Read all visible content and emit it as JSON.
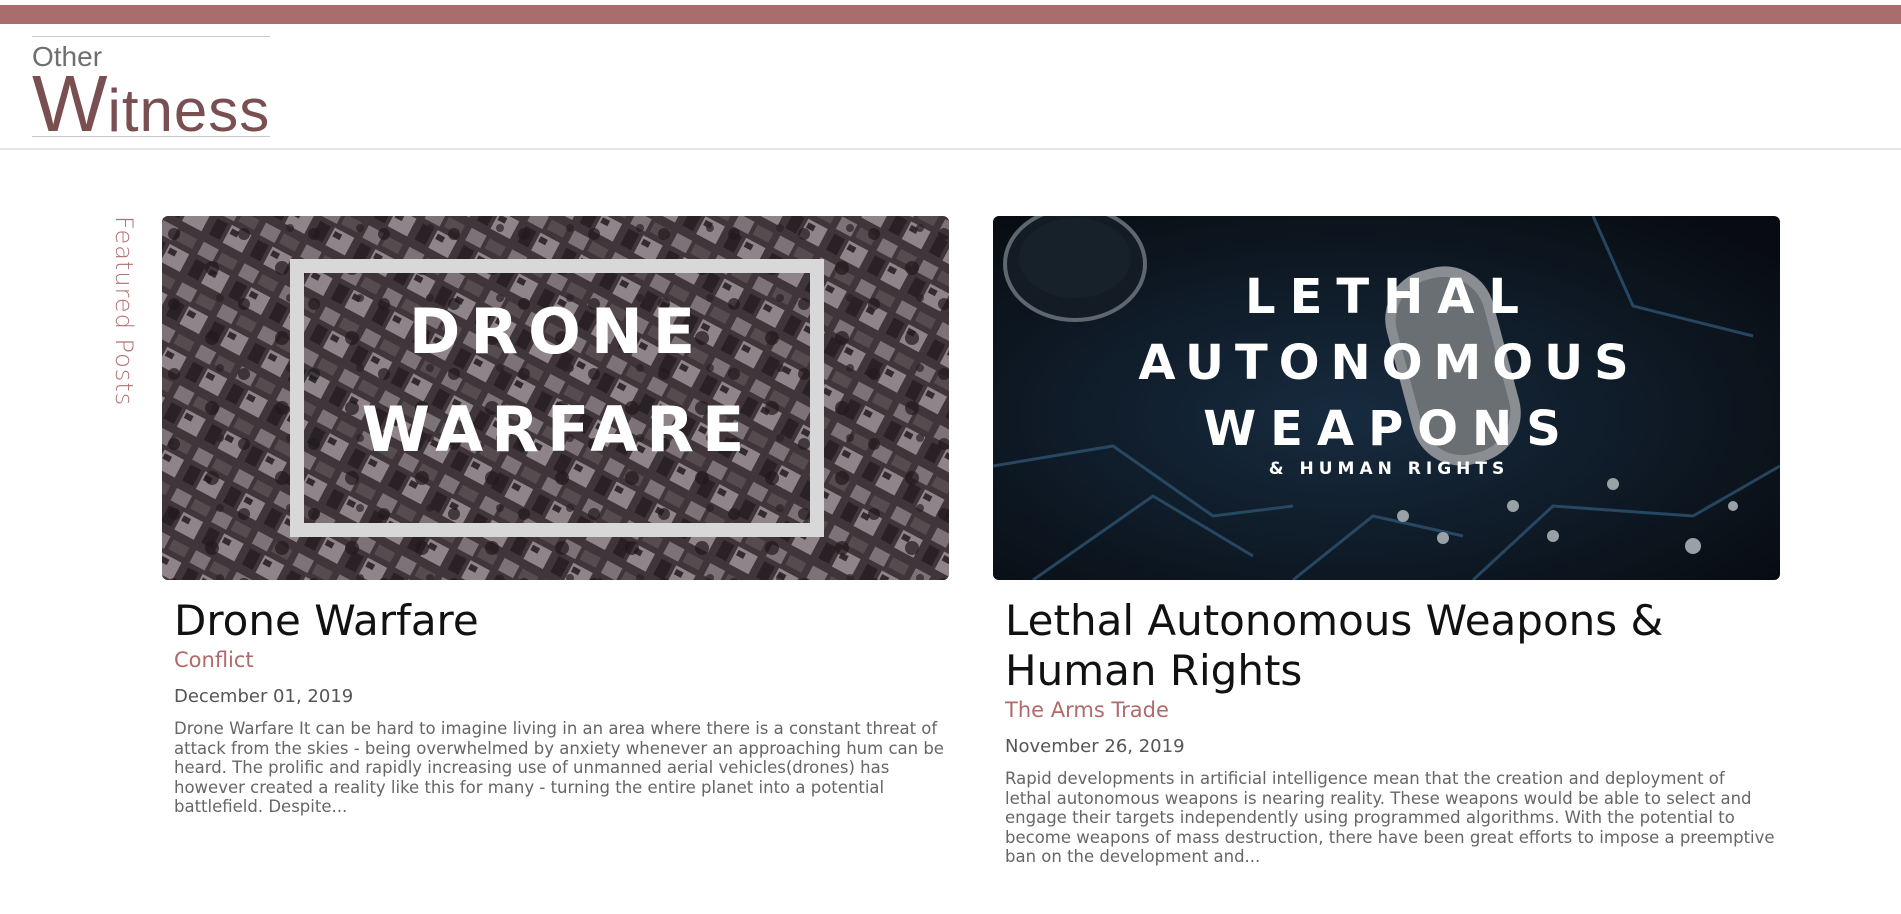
{
  "site": {
    "logo_small": "Other",
    "logo_big_initial": "W",
    "logo_big_rest": "itness"
  },
  "featured_label": "Featured Posts",
  "posts": [
    {
      "title": "Drone Warfare",
      "category": "Conflict",
      "date": "December 01, 2019",
      "excerpt": "Drone Warfare It can be hard to imagine living in an area where there is a constant threat of attack from the skies - being overwhelmed by anxiety whenever an approaching hum can be heard. The prolific and rapidly increasing use of unmanned aerial vehicles(drones) has however created a reality like this for many - turning the entire planet into a potential battlefield. Despite...",
      "image_text": {
        "line1": "DRONE",
        "line2": "WARFARE"
      }
    },
    {
      "title": "Lethal Autonomous Weapons & Human Rights",
      "category": "The Arms Trade",
      "date": "November 26, 2019",
      "excerpt": "Rapid developments in artificial intelligence mean that the creation and deployment of lethal autonomous weapons is nearing reality. These weapons would be able to select and engage their targets independently using programmed algorithms. With the potential to become weapons of mass destruction, there have been great efforts to impose a preemptive ban on the development and...",
      "image_text": {
        "line1": "LETHAL",
        "line2": "AUTONOMOUS",
        "line3": "WEAPONS",
        "line4": "& HUMAN RIGHTS"
      }
    }
  ],
  "colors": {
    "accent": "#a96d6d",
    "logo": "#7a4f52",
    "category": "#b06a6a"
  }
}
